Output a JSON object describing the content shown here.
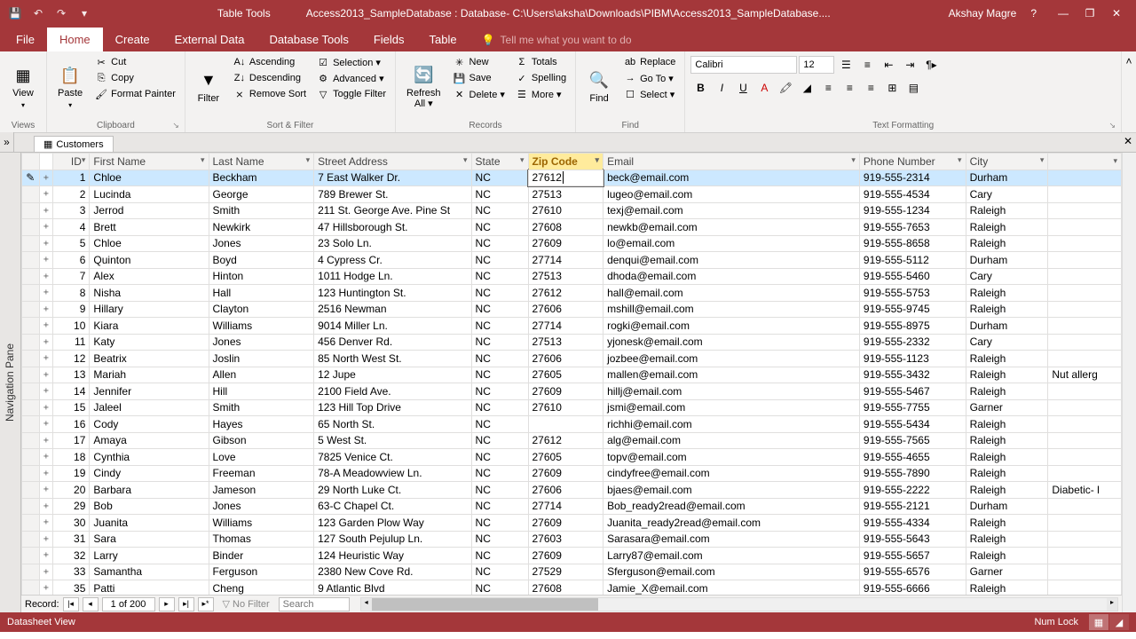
{
  "titlebar": {
    "table_tools": "Table Tools",
    "filename": "Access2013_SampleDatabase : Database- C:\\Users\\aksha\\Downloads\\PIBM\\Access2013_SampleDatabase....",
    "user": "Akshay Magre"
  },
  "tabs": {
    "file": "File",
    "home": "Home",
    "create": "Create",
    "external": "External Data",
    "dbtools": "Database Tools",
    "fields": "Fields",
    "table": "Table",
    "tellme": "Tell me what you want to do"
  },
  "ribbon": {
    "views": {
      "view": "View",
      "label": "Views"
    },
    "clipboard": {
      "paste": "Paste",
      "cut": "Cut",
      "copy": "Copy",
      "fmt": "Format Painter",
      "label": "Clipboard"
    },
    "sort": {
      "filter": "Filter",
      "asc": "Ascending",
      "desc": "Descending",
      "remove": "Remove Sort",
      "sel": "Selection ▾",
      "adv": "Advanced ▾",
      "toggle": "Toggle Filter",
      "label": "Sort & Filter"
    },
    "records": {
      "refresh": "Refresh\nAll ▾",
      "new": "New",
      "save": "Save",
      "delete": "Delete  ▾",
      "totals": "Totals",
      "spell": "Spelling",
      "more": "More ▾",
      "label": "Records"
    },
    "find": {
      "find": "Find",
      "replace": "Replace",
      "goto": "Go To ▾",
      "select": "Select ▾",
      "label": "Find"
    },
    "fmt": {
      "font": "Calibri",
      "size": "12",
      "label": "Text Formatting"
    }
  },
  "doc_tab": {
    "name": "Customers",
    "nav_pane": "Navigation Pane"
  },
  "columns": [
    "ID",
    "First Name",
    "Last Name",
    "Street Address",
    "State",
    "Zip Code",
    "Email",
    "Phone Number",
    "City",
    ""
  ],
  "sorted_col": 5,
  "editing_cell": {
    "row": 0,
    "col": 5,
    "value": "27612"
  },
  "rows": [
    {
      "id": 1,
      "fn": "Chloe",
      "ln": "Beckham",
      "addr": "7 East Walker Dr.",
      "st": "NC",
      "zip": "27612",
      "email": "beck@email.com",
      "ph": "919-555-2314",
      "city": "Durham",
      "ex": ""
    },
    {
      "id": 2,
      "fn": "Lucinda",
      "ln": "George",
      "addr": "789 Brewer St.",
      "st": "NC",
      "zip": "27513",
      "email": "lugeo@email.com",
      "ph": "919-555-4534",
      "city": "Cary",
      "ex": ""
    },
    {
      "id": 3,
      "fn": "Jerrod",
      "ln": "Smith",
      "addr": "211 St. George Ave. Pine St",
      "st": "NC",
      "zip": "27610",
      "email": "texj@email.com",
      "ph": "919-555-1234",
      "city": "Raleigh",
      "ex": ""
    },
    {
      "id": 4,
      "fn": "Brett",
      "ln": "Newkirk",
      "addr": "47 Hillsborough St.",
      "st": "NC",
      "zip": "27608",
      "email": "newkb@email.com",
      "ph": "919-555-7653",
      "city": "Raleigh",
      "ex": ""
    },
    {
      "id": 5,
      "fn": "Chloe",
      "ln": "Jones",
      "addr": "23 Solo Ln.",
      "st": "NC",
      "zip": "27609",
      "email": "lo@email.com",
      "ph": "919-555-8658",
      "city": "Raleigh",
      "ex": ""
    },
    {
      "id": 6,
      "fn": "Quinton",
      "ln": "Boyd",
      "addr": "4 Cypress Cr.",
      "st": "NC",
      "zip": "27714",
      "email": "denqui@email.com",
      "ph": "919-555-5112",
      "city": "Durham",
      "ex": ""
    },
    {
      "id": 7,
      "fn": "Alex",
      "ln": "Hinton",
      "addr": "1011 Hodge Ln.",
      "st": "NC",
      "zip": "27513",
      "email": "dhoda@email.com",
      "ph": "919-555-5460",
      "city": "Cary",
      "ex": ""
    },
    {
      "id": 8,
      "fn": "Nisha",
      "ln": "Hall",
      "addr": "123 Huntington St.",
      "st": "NC",
      "zip": "27612",
      "email": "hall@email.com",
      "ph": "919-555-5753",
      "city": "Raleigh",
      "ex": ""
    },
    {
      "id": 9,
      "fn": "Hillary",
      "ln": "Clayton",
      "addr": "2516 Newman",
      "st": "NC",
      "zip": "27606",
      "email": "mshill@email.com",
      "ph": "919-555-9745",
      "city": "Raleigh",
      "ex": ""
    },
    {
      "id": 10,
      "fn": "Kiara",
      "ln": "Williams",
      "addr": "9014 Miller Ln.",
      "st": "NC",
      "zip": "27714",
      "email": "rogki@email.com",
      "ph": "919-555-8975",
      "city": "Durham",
      "ex": ""
    },
    {
      "id": 11,
      "fn": "Katy",
      "ln": "Jones",
      "addr": "456 Denver Rd.",
      "st": "NC",
      "zip": "27513",
      "email": "yjonesk@email.com",
      "ph": "919-555-2332",
      "city": "Cary",
      "ex": ""
    },
    {
      "id": 12,
      "fn": "Beatrix",
      "ln": "Joslin",
      "addr": "85 North West St.",
      "st": "NC",
      "zip": "27606",
      "email": "jozbee@email.com",
      "ph": "919-555-1123",
      "city": "Raleigh",
      "ex": ""
    },
    {
      "id": 13,
      "fn": "Mariah",
      "ln": "Allen",
      "addr": "12 Jupe",
      "st": "NC",
      "zip": "27605",
      "email": "mallen@email.com",
      "ph": "919-555-3432",
      "city": "Raleigh",
      "ex": "Nut allerg"
    },
    {
      "id": 14,
      "fn": "Jennifer",
      "ln": "Hill",
      "addr": "2100 Field Ave.",
      "st": "NC",
      "zip": "27609",
      "email": "hillj@email.com",
      "ph": "919-555-5467",
      "city": "Raleigh",
      "ex": ""
    },
    {
      "id": 15,
      "fn": "Jaleel",
      "ln": "Smith",
      "addr": "123 Hill Top Drive",
      "st": "NC",
      "zip": "27610",
      "email": "jsmi@email.com",
      "ph": "919-555-7755",
      "city": "Garner",
      "ex": ""
    },
    {
      "id": 16,
      "fn": "Cody",
      "ln": "Hayes",
      "addr": "65 North St.",
      "st": "NC",
      "zip": "",
      "email": "richhi@email.com",
      "ph": "919-555-5434",
      "city": "Raleigh",
      "ex": ""
    },
    {
      "id": 17,
      "fn": "Amaya",
      "ln": "Gibson",
      "addr": "5 West St.",
      "st": "NC",
      "zip": "27612",
      "email": "alg@email.com",
      "ph": "919-555-7565",
      "city": "Raleigh",
      "ex": ""
    },
    {
      "id": 18,
      "fn": "Cynthia",
      "ln": "Love",
      "addr": "7825 Venice Ct.",
      "st": "NC",
      "zip": "27605",
      "email": "topv@email.com",
      "ph": "919-555-4655",
      "city": "Raleigh",
      "ex": ""
    },
    {
      "id": 19,
      "fn": "Cindy",
      "ln": "Freeman",
      "addr": "78-A Meadowview Ln.",
      "st": "NC",
      "zip": "27609",
      "email": "cindyfree@email.com",
      "ph": "919-555-7890",
      "city": "Raleigh",
      "ex": ""
    },
    {
      "id": 20,
      "fn": "Barbara",
      "ln": "Jameson",
      "addr": "29 North Luke Ct.",
      "st": "NC",
      "zip": "27606",
      "email": "bjaes@email.com",
      "ph": "919-555-2222",
      "city": "Raleigh",
      "ex": "Diabetic- l"
    },
    {
      "id": 29,
      "fn": "Bob",
      "ln": "Jones",
      "addr": "63-C Chapel Ct.",
      "st": "NC",
      "zip": "27714",
      "email": "Bob_ready2read@email.com",
      "ph": "919-555-2121",
      "city": "Durham",
      "ex": ""
    },
    {
      "id": 30,
      "fn": "Juanita",
      "ln": "Williams",
      "addr": "123 Garden Plow Way",
      "st": "NC",
      "zip": "27609",
      "email": "Juanita_ready2read@email.com",
      "ph": "919-555-4334",
      "city": "Raleigh",
      "ex": ""
    },
    {
      "id": 31,
      "fn": "Sara",
      "ln": "Thomas",
      "addr": "127 South Pejulup Ln.",
      "st": "NC",
      "zip": "27603",
      "email": "Sarasara@email.com",
      "ph": "919-555-5643",
      "city": "Raleigh",
      "ex": ""
    },
    {
      "id": 32,
      "fn": "Larry",
      "ln": "Binder",
      "addr": "124 Heuristic Way",
      "st": "NC",
      "zip": "27609",
      "email": "Larry87@email.com",
      "ph": "919-555-5657",
      "city": "Raleigh",
      "ex": ""
    },
    {
      "id": 33,
      "fn": "Samantha",
      "ln": "Ferguson",
      "addr": "2380 New Cove Rd.",
      "st": "NC",
      "zip": "27529",
      "email": "Sferguson@email.com",
      "ph": "919-555-6576",
      "city": "Garner",
      "ex": ""
    },
    {
      "id": 35,
      "fn": "Patti",
      "ln": "Cheng",
      "addr": "9 Atlantic Blvd",
      "st": "NC",
      "zip": "27608",
      "email": "Jamie_X@email.com",
      "ph": "919-555-6666",
      "city": "Raleigh",
      "ex": ""
    }
  ],
  "recnav": {
    "label": "Record:",
    "pos": "1 of 200",
    "nofilter": "No Filter",
    "search": "Search"
  },
  "status": {
    "view": "Datasheet View",
    "numlock": "Num Lock"
  }
}
